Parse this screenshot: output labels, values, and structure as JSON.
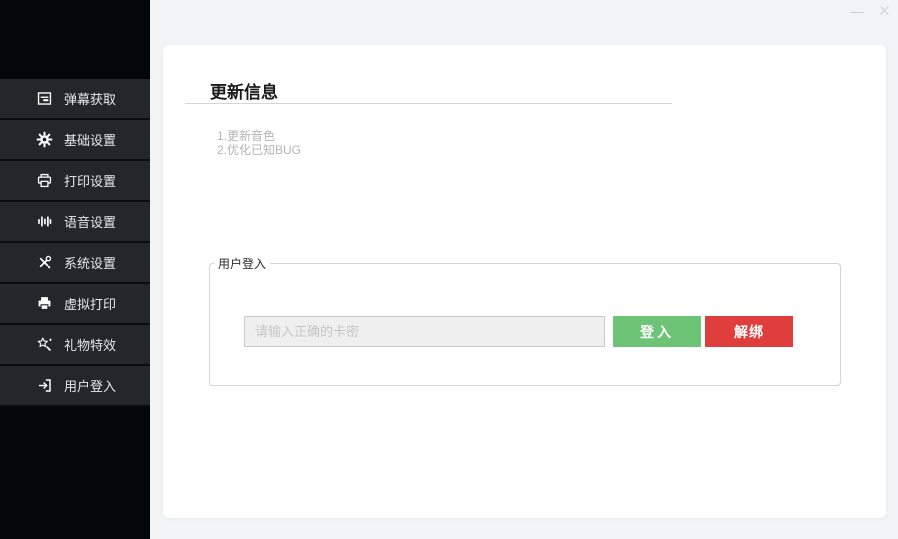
{
  "window": {
    "minimize_glyph": "—",
    "close_glyph": "×"
  },
  "sidebar": {
    "items": [
      {
        "label": "弹幕获取",
        "icon": "danmaku-icon"
      },
      {
        "label": "基础设置",
        "icon": "gear-icon"
      },
      {
        "label": "打印设置",
        "icon": "printer-icon"
      },
      {
        "label": "语音设置",
        "icon": "waveform-icon"
      },
      {
        "label": "系统设置",
        "icon": "tools-icon"
      },
      {
        "label": "虚拟打印",
        "icon": "printer-filled-icon"
      },
      {
        "label": "礼物特效",
        "icon": "star-wand-icon"
      },
      {
        "label": "用户登入",
        "icon": "login-icon"
      }
    ]
  },
  "main": {
    "title": "更新信息",
    "update_notes": [
      "1.更新音色",
      "2.优化已知BUG"
    ],
    "login": {
      "legend": "用户登入",
      "input_placeholder": "请输入正确的卡密",
      "input_value": "",
      "login_button": "登入",
      "unbind_button": "解绑"
    }
  },
  "colors": {
    "login_green": "#6ec476",
    "unbind_red": "#e03e3c"
  }
}
